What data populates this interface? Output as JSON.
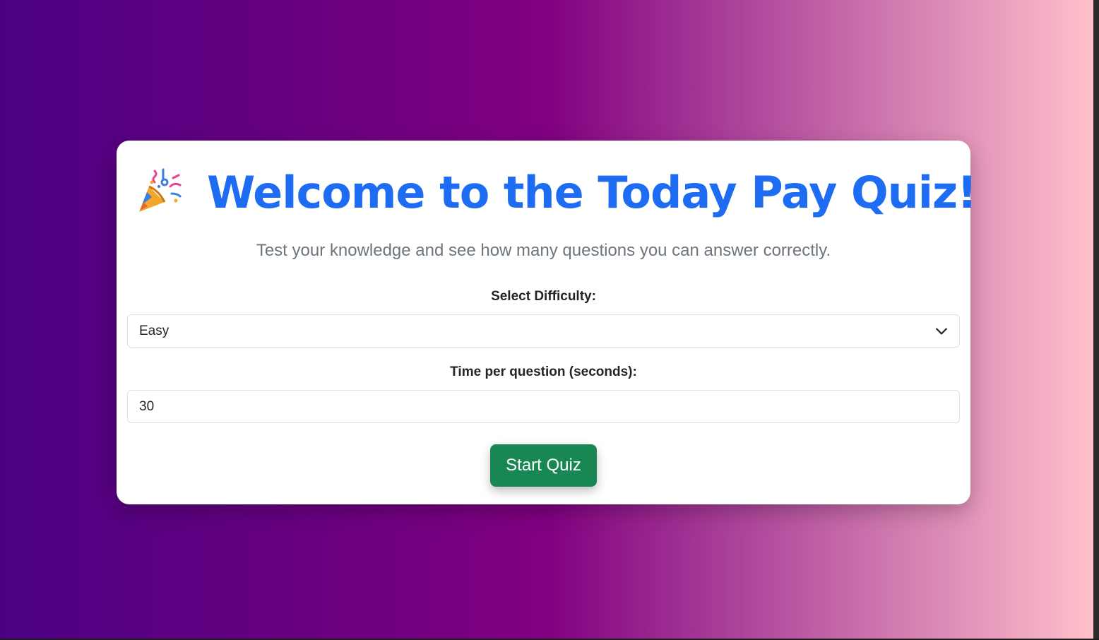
{
  "page": {
    "title": "Welcome to the Today Pay Quiz!",
    "subtitle": "Test your knowledge and see how many questions you can answer correctly.",
    "title_icon": "party-popper-icon"
  },
  "form": {
    "difficulty_label": "Select Difficulty:",
    "difficulty_value": "Easy",
    "time_label": "Time per question (seconds):",
    "time_value": "30",
    "start_button": "Start Quiz"
  },
  "colors": {
    "gradient_start": "#4b0082",
    "gradient_mid": "#800080",
    "gradient_end": "#ffc0cb",
    "title": "#1d6cf2",
    "button": "#198754"
  }
}
